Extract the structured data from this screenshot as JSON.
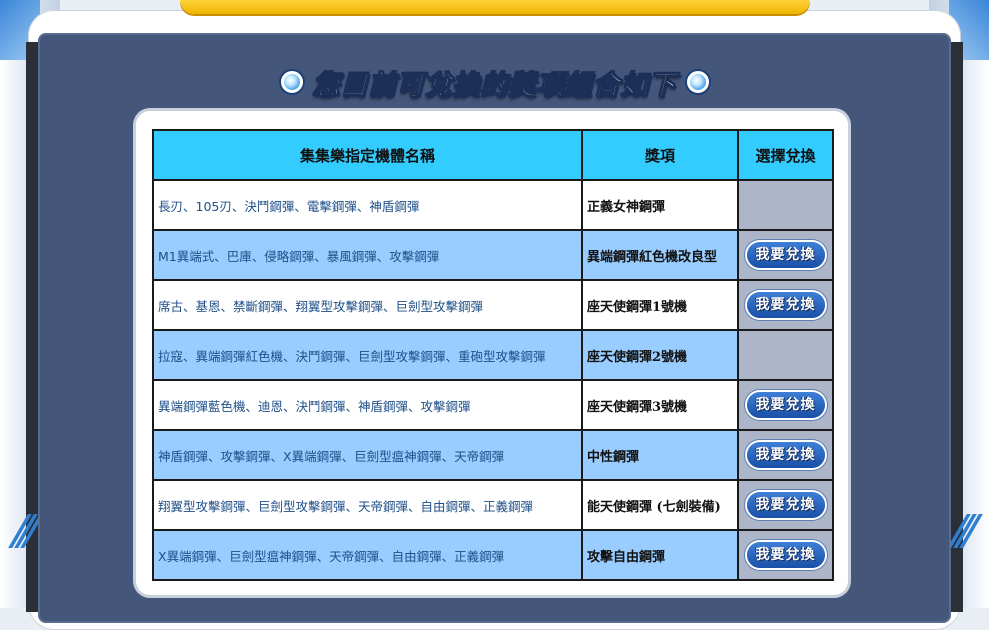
{
  "heading": {
    "title": "您目前可兌換的獎項組合如下"
  },
  "table": {
    "headers": {
      "name": "集集樂指定機體名稱",
      "award": "獎項",
      "select": "選擇兌換"
    },
    "rows": [
      {
        "name": "長刃、105刃、決鬥鋼彈、電擊鋼彈、神盾鋼彈",
        "award": "正義女神鋼彈",
        "redeemable": false,
        "button": ""
      },
      {
        "name": "M1異端式、巴庫、侵略鋼彈、暴風鋼彈、攻擊鋼彈",
        "award": "異端鋼彈紅色機改良型",
        "redeemable": true,
        "button": "我要兌換"
      },
      {
        "name": "席古、基恩、禁斷鋼彈、翔翼型攻擊鋼彈、巨劍型攻擊鋼彈",
        "award": "座天使鋼彈1號機",
        "redeemable": true,
        "button": "我要兌換"
      },
      {
        "name": "拉寇、異端鋼彈紅色機、決鬥鋼彈、巨劍型攻擊鋼彈、重砲型攻擊鋼彈",
        "award": "座天使鋼彈2號機",
        "redeemable": false,
        "button": ""
      },
      {
        "name": "異端鋼彈藍色機、迪恩、決鬥鋼彈、神盾鋼彈、攻擊鋼彈",
        "award": "座天使鋼彈3號機",
        "redeemable": true,
        "button": "我要兌換"
      },
      {
        "name": "神盾鋼彈、攻擊鋼彈、X異端鋼彈、巨劍型瘟神鋼彈、天帝鋼彈",
        "award": "中性鋼彈",
        "redeemable": true,
        "button": "我要兌換"
      },
      {
        "name": "翔翼型攻擊鋼彈、巨劍型攻擊鋼彈、天帝鋼彈、自由鋼彈、正義鋼彈",
        "award": "能天使鋼彈 (七劍裝備)",
        "redeemable": true,
        "button": "我要兌換"
      },
      {
        "name": "X異端鋼彈、巨劍型瘟神鋼彈、天帝鋼彈、自由鋼彈、正義鋼彈",
        "award": "攻擊自由鋼彈",
        "redeemable": true,
        "button": "我要兌換"
      }
    ]
  }
}
